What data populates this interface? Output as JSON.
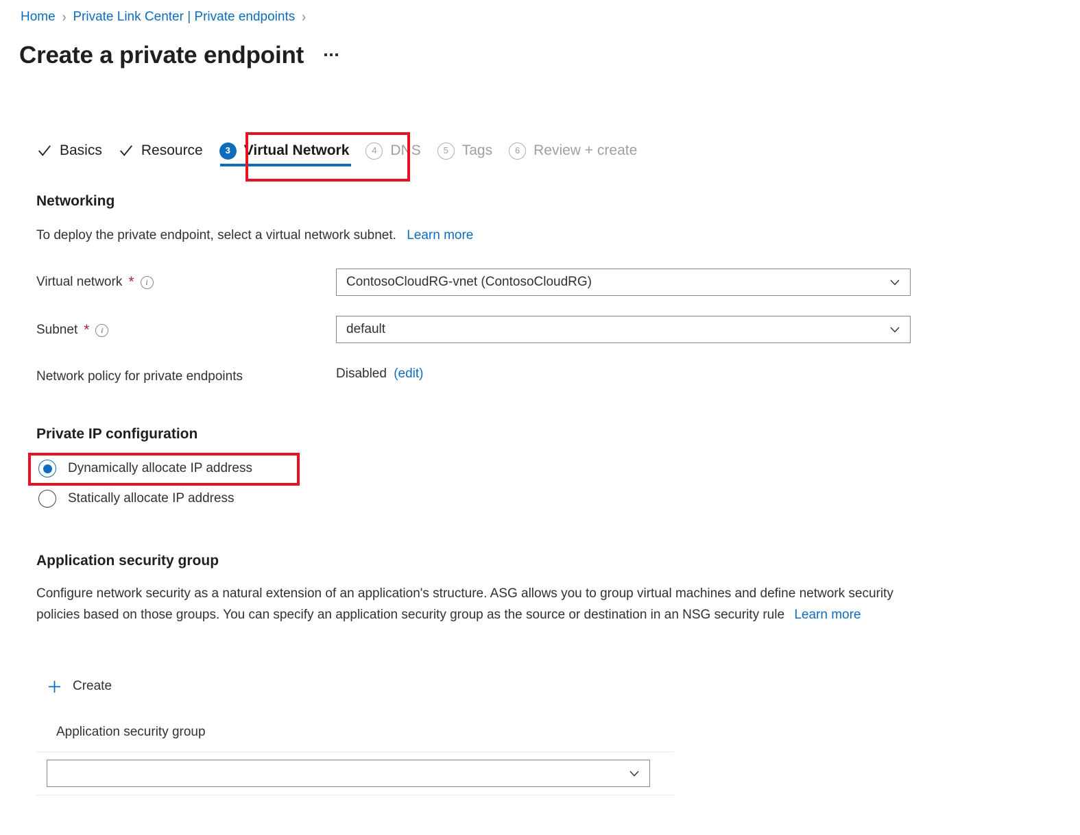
{
  "breadcrumb": {
    "items": [
      {
        "label": "Home"
      },
      {
        "label": "Private Link Center | Private endpoints"
      }
    ],
    "separator": "›"
  },
  "header": {
    "title": "Create a private endpoint",
    "more_menu": "more-commands"
  },
  "tabs": [
    {
      "label": "Basics",
      "state": "done",
      "indicator": "check"
    },
    {
      "label": "Resource",
      "state": "done",
      "indicator": "check"
    },
    {
      "label": "Virtual Network",
      "state": "active",
      "indicator": "3",
      "highlighted": true
    },
    {
      "label": "DNS",
      "state": "disabled",
      "indicator": "4"
    },
    {
      "label": "Tags",
      "state": "disabled",
      "indicator": "5"
    },
    {
      "label": "Review + create",
      "state": "disabled",
      "indicator": "6"
    }
  ],
  "networking": {
    "heading": "Networking",
    "description": "To deploy the private endpoint, select a virtual network subnet.",
    "learn_more": "Learn more",
    "virtual_network": {
      "label": "Virtual network",
      "required": "*",
      "info": "info-icon",
      "value": "ContosoCloudRG-vnet (ContosoCloudRG)"
    },
    "subnet": {
      "label": "Subnet",
      "required": "*",
      "info": "info-icon",
      "value": "default"
    },
    "network_policy": {
      "label": "Network policy for private endpoints",
      "value": "Disabled",
      "edit_link": "(edit)"
    }
  },
  "private_ip": {
    "heading": "Private IP configuration",
    "options": [
      {
        "label": "Dynamically allocate IP address",
        "selected": true,
        "highlighted": true
      },
      {
        "label": "Statically allocate IP address",
        "selected": false,
        "highlighted": false
      }
    ]
  },
  "application_security_group": {
    "heading": "Application security group",
    "description": "Configure network security as a natural extension of an application's structure. ASG allows you to group virtual machines and define network security policies based on those groups. You can specify an application security group as the source or destination in an NSG security rule",
    "learn_more": "Learn more",
    "create_button": "Create",
    "create_icon": "plus-icon",
    "table_header": "Application security group",
    "dropdown_value": ""
  },
  "colors": {
    "accent_blue": "#0f6cbd",
    "highlight_red": "#e81123",
    "required_red": "#a4262c",
    "disabled_gray": "#a19f9d",
    "text_dark": "#201f1e"
  }
}
